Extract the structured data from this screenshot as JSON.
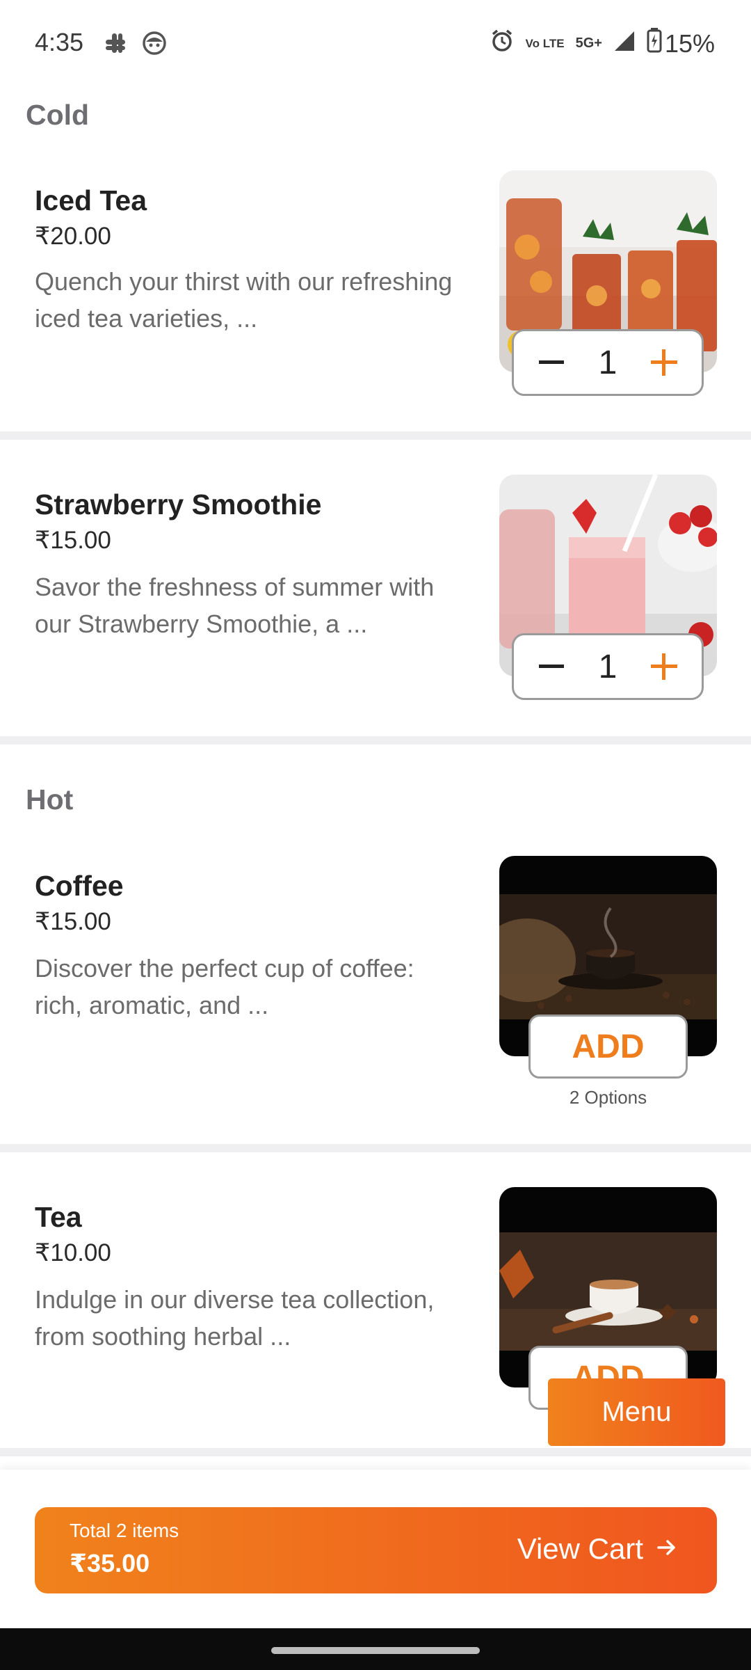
{
  "status_bar": {
    "time": "4:35",
    "network_volte": "Vo LTE",
    "network_5g": "5G+",
    "battery": "15%"
  },
  "sections": [
    {
      "title": "Cold"
    },
    {
      "title": "Hot"
    }
  ],
  "items": [
    {
      "name": "Iced Tea",
      "price": "₹20.00",
      "description": "Quench your thirst with our refreshing iced tea varieties, ...",
      "quantity": "1"
    },
    {
      "name": "Strawberry Smoothie",
      "price": "₹15.00",
      "description": "Savor the freshness of summer with our Strawberry Smoothie, a ...",
      "quantity": "1"
    },
    {
      "name": "Coffee",
      "price": "₹15.00",
      "description": "Discover the perfect cup of coffee: rich, aromatic, and ...",
      "add_label": "ADD",
      "options": "2 Options"
    },
    {
      "name": "Tea",
      "price": "₹10.00",
      "description": "Indulge in our diverse tea collection, from soothing herbal ...",
      "add_label": "ADD"
    }
  ],
  "menu_button": "Menu",
  "cart": {
    "total_label": "Total 2 items",
    "total": "₹35.00",
    "view_cart": "View Cart"
  },
  "colors": {
    "accent": "#ee7d1e",
    "gradient_start": "#f0821c",
    "gradient_end": "#f0561f"
  }
}
